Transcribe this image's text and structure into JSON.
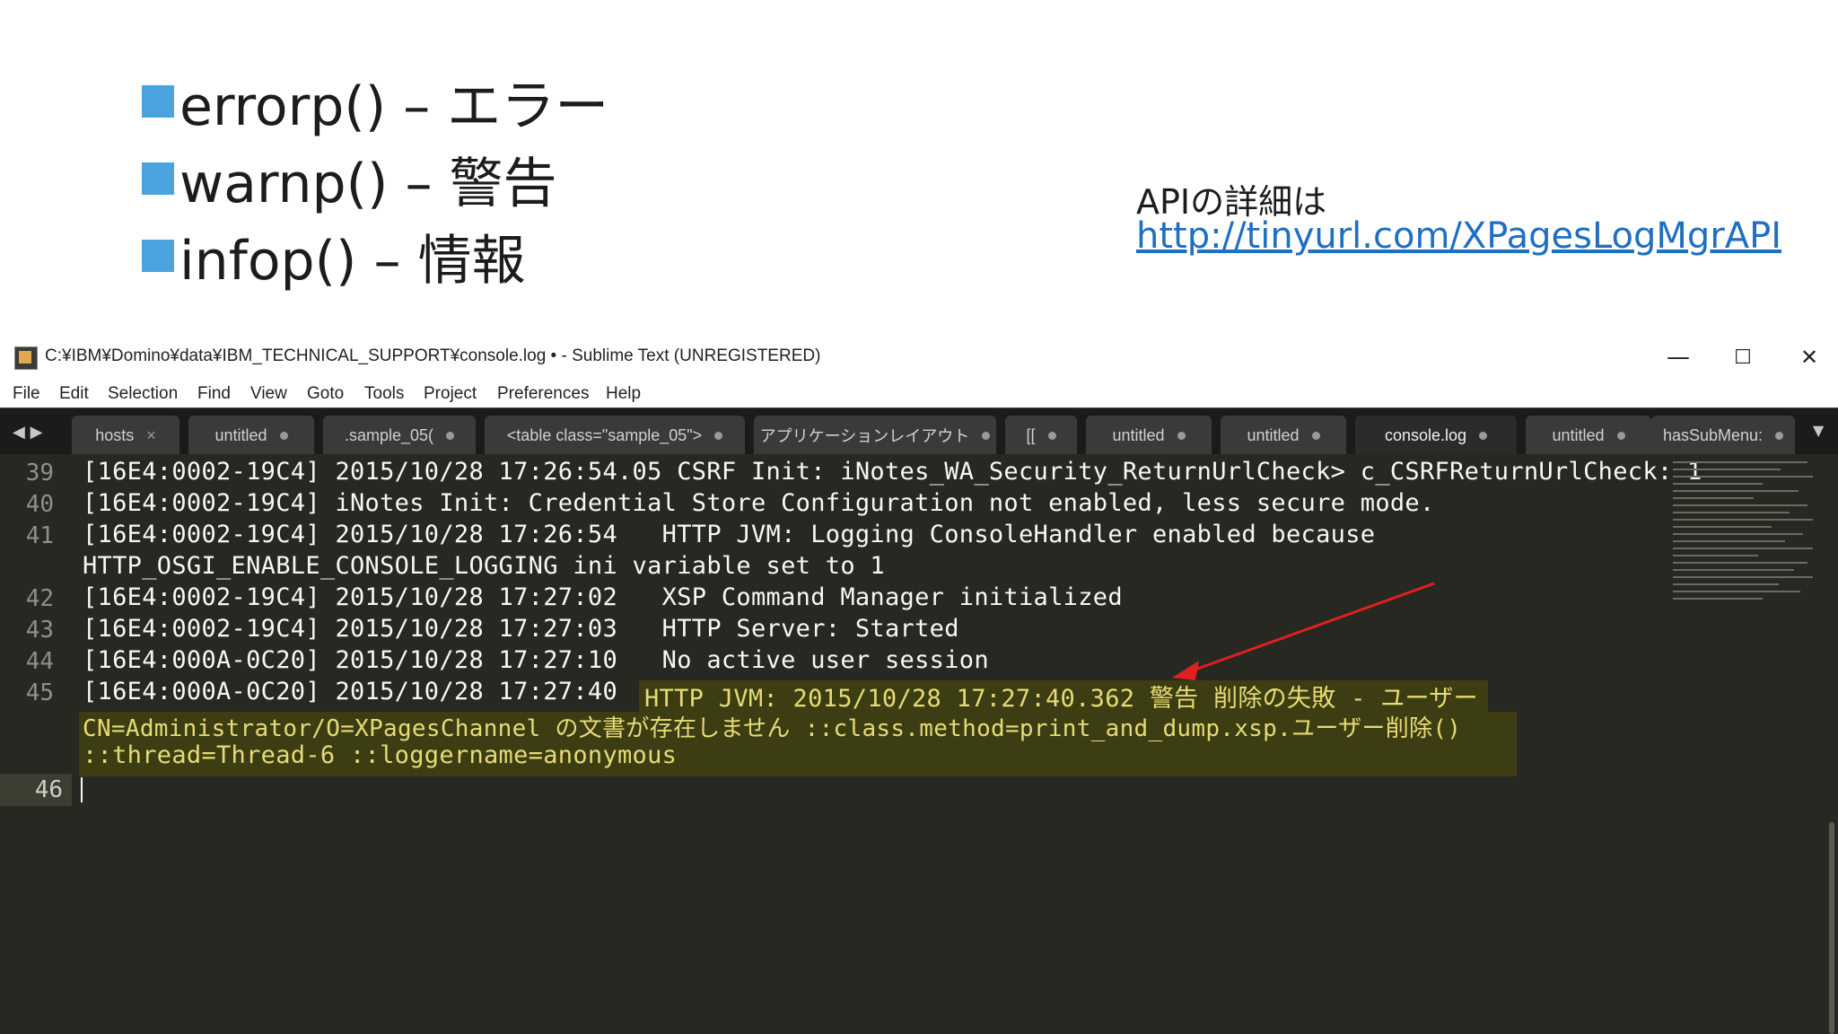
{
  "slide": {
    "bullets": [
      {
        "label": "errorp() – エラー"
      },
      {
        "label": "warnp() – 警告"
      },
      {
        "label": "infop() – 情報"
      }
    ],
    "api_title": "APIの詳細は",
    "api_link": "http://tinyurl.com/XPagesLogMgrAPI"
  },
  "window": {
    "title": "C:¥IBM¥Domino¥data¥IBM_TECHNICAL_SUPPORT¥console.log • - Sublime Text (UNREGISTERED)",
    "controls": {
      "minimize": "—",
      "maximize": "☐",
      "close": "✕"
    },
    "menu": [
      "File",
      "Edit",
      "Selection",
      "Find",
      "View",
      "Goto",
      "Tools",
      "Project",
      "Preferences",
      "Help"
    ],
    "tabs": [
      {
        "label": "hosts"
      },
      {
        "label": "untitled"
      },
      {
        "label": ".sample_05("
      },
      {
        "label": "<table class=\"sample_05\">"
      },
      {
        "label": "アプリケーションレイアウト"
      },
      {
        "label": "[["
      },
      {
        "label": "untitled"
      },
      {
        "label": "untitled"
      },
      {
        "label": "console.log"
      },
      {
        "label": "untitled"
      },
      {
        "label": "hasSubMenu:"
      }
    ],
    "tab_arrows": "◀ ▶",
    "tab_dropdown": "▼"
  },
  "editor": {
    "line_numbers": [
      "39",
      "40",
      "41",
      "42",
      "43",
      "44",
      "45",
      "46"
    ],
    "lines": [
      "[16E4:0002-19C4] 2015/10/28 17:26:54.05 CSRF Init: iNotes_WA_Security_ReturnUrlCheck> c_CSRFReturnUrlCheck: 1",
      "[16E4:0002-19C4] iNotes Init: Credential Store Configuration not enabled, less secure mode.",
      "[16E4:0002-19C4] 2015/10/28 17:26:54   HTTP JVM: Logging ConsoleHandler enabled because",
      "HTTP_OSGI_ENABLE_CONSOLE_LOGGING ini variable set to 1",
      "[16E4:0002-19C4] 2015/10/28 17:27:02   XSP Command Manager initialized",
      "[16E4:0002-19C4] 2015/10/28 17:27:03   HTTP Server: Started",
      "[16E4:000A-0C20] 2015/10/28 17:27:10   No active user session",
      "[16E4:000A-0C20] 2015/10/28 17:27:40"
    ],
    "warning_lines": [
      "HTTP JVM: 2015/10/28 17:27:40.362 警告 削除の失敗 - ユーザー",
      "CN=Administrator/O=XPagesChannel の文書が存在しません ::class.method=print_and_dump.xsp.ユーザー削除()",
      "::thread=Thread-6 ::loggername=anonymous"
    ]
  },
  "colors": {
    "bullet": "#4aa3df",
    "link": "#1f6fc2",
    "editor_bg": "#272822",
    "highlight_bg": "#3d3d14",
    "warning_text": "#e6db74",
    "arrow": "#e02020"
  }
}
